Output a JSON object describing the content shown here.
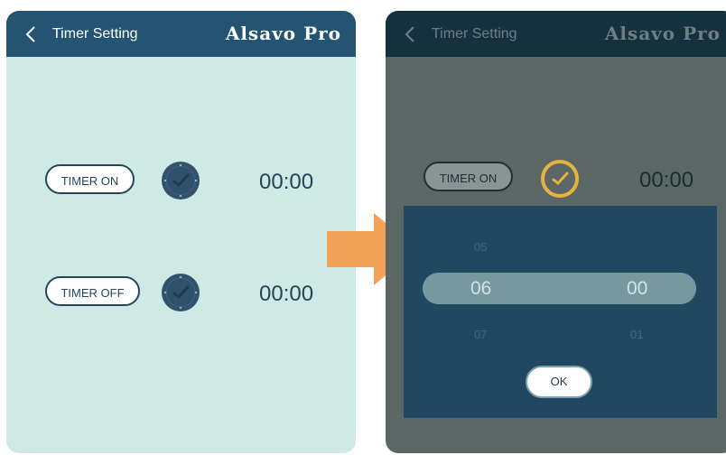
{
  "left": {
    "header": {
      "title": "Timer Setting",
      "brand": "Alsavo Pro"
    },
    "timer_on": {
      "label": "TIMER ON",
      "time": "00:00"
    },
    "timer_off": {
      "label": "TIMER OFF",
      "time": "00:00"
    }
  },
  "right": {
    "header": {
      "title": "Timer Setting",
      "brand": "Alsavo Pro"
    },
    "timer_on": {
      "label": "TIMER ON",
      "time": "00:00"
    },
    "picker": {
      "hours": {
        "prev": "05",
        "selected": "06",
        "next": "07"
      },
      "minutes": {
        "selected": "00",
        "next": "01"
      },
      "ok_label": "OK"
    }
  },
  "colors": {
    "header": "#245471",
    "panel_bg": "#cfe9e4",
    "clock": "#30506b",
    "clock_active": "#e5b33d",
    "arrow": "#f2a257",
    "picker_bg": "#224861"
  },
  "icons": {
    "back": "chevron-left-icon",
    "clock": "clock-icon",
    "arrow": "arrow-right-icon"
  }
}
